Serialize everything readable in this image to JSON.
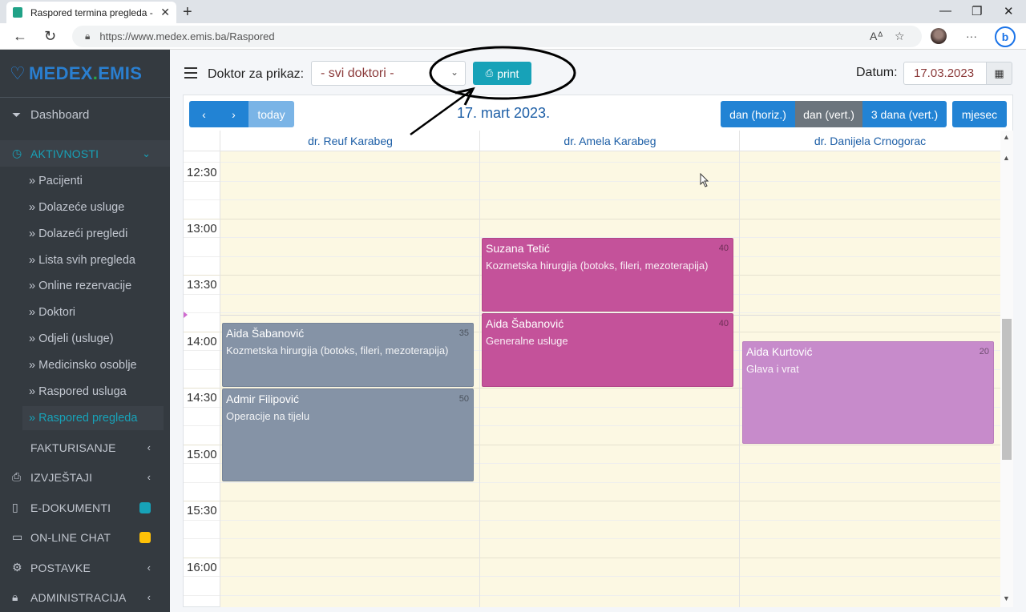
{
  "browser": {
    "tab_title": "Raspored termina pregleda - MEDEX.EMIS",
    "new_tab": "+",
    "url_domain": "https://www.medex.emis.ba",
    "url_path": "/Raspored"
  },
  "sidebar": {
    "logo_main": "MEDEX",
    "logo_dot": ".",
    "logo_second": "EMIS",
    "dashboard": "Dashboard",
    "aktivnosti": "AKTIVNOSTI",
    "sub_items": [
      "» Pacijenti",
      "» Dolazeće usluge",
      "» Dolazeći pregledi",
      "» Lista svih pregleda",
      "» Online rezervacije",
      "» Doktori",
      "» Odjeli (usluge)",
      "» Medicinsko osoblje",
      "» Raspored usluga",
      "» Raspored pregleda"
    ],
    "groups": [
      "FAKTURISANJE",
      "IZVJEŠTAJI",
      "E-DOKUMENTI",
      "ON-LINE CHAT",
      "POSTAVKE",
      "ADMINISTRACIJA"
    ],
    "colors": {
      "bg": "#343a40",
      "active": "#17a2b8",
      "edok_badge": "#17a2b8",
      "chat_badge": "#ffc107"
    }
  },
  "header": {
    "doctor_label": "Doktor za prikaz:",
    "doctor_select": "- svi doktori -",
    "print_label": "print",
    "date_label": "Datum:",
    "date_value": "17.03.2023"
  },
  "calendar": {
    "prev": "‹",
    "next": "›",
    "today": "today",
    "title": "17. mart 2023.",
    "views": [
      "dan (horiz.)",
      "dan (vert.)",
      "3 dana (vert.)",
      "mjesec"
    ],
    "doctors": [
      "dr. Reuf Karabeg",
      "dr. Amela Karabeg",
      "dr. Danijela Crnogorac"
    ],
    "times": [
      "12:30",
      "13:00",
      "13:30",
      "14:00",
      "14:30",
      "15:00",
      "15:30",
      "16:00"
    ],
    "events": [
      {
        "name": "Suzana Tetić",
        "num": "40",
        "desc": "Kozmetska hirurgija (botoks, fileri, mezoterapija)"
      },
      {
        "name": "Aida Šabanović",
        "num": "40",
        "desc": "Generalne usluge"
      },
      {
        "name": "Aida Šabanović",
        "num": "35",
        "desc": "Kozmetska hirurgija (botoks, fileri, mezoterapija)"
      },
      {
        "name": "Admir Filipović",
        "num": "50",
        "desc": "Operacije na tijelu"
      },
      {
        "name": "Aida Kurtović",
        "num": "20",
        "desc": "Glava i vrat"
      }
    ]
  },
  "icons": {
    "heart": "heart-pulse-icon",
    "tag": "tag-icon",
    "clock": "clock-icon",
    "printer": "printer-icon",
    "file": "file-icon",
    "chat": "chat-icon",
    "gear": "gear-icon",
    "lock": "lock-icon",
    "calendar": "calendar-icon"
  }
}
